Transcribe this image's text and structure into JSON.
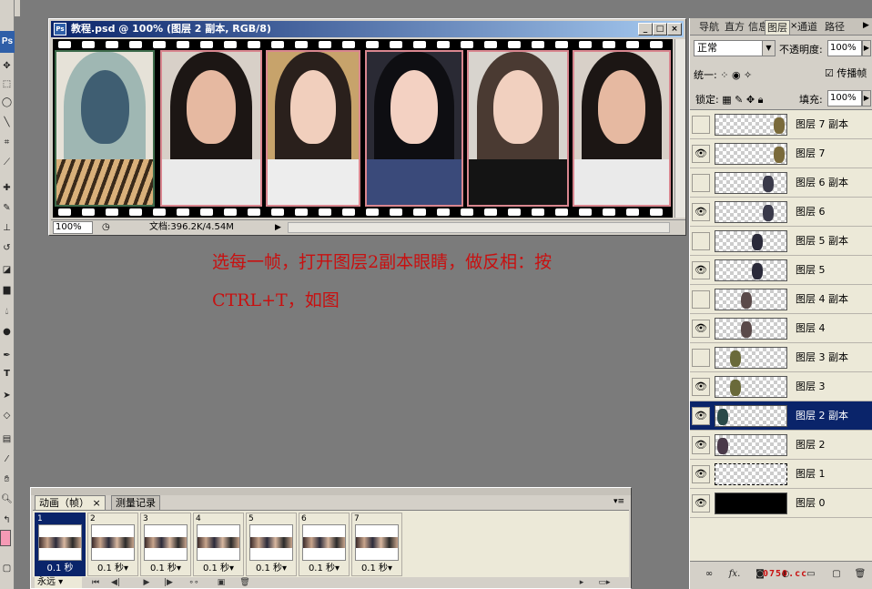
{
  "document": {
    "title": "教程.psd @ 100% (图层 2 副本, RGB/8)",
    "zoom": "100%",
    "info": "文档:396.2K/4.54M",
    "window_buttons": [
      "_",
      "□",
      "×"
    ]
  },
  "toolbox": {
    "logo": "Ps",
    "tools": [
      "move-icon",
      "marquee-icon",
      "lasso-icon",
      "wand-icon",
      "crop-icon",
      "slice-icon",
      "heal-icon",
      "brush-icon",
      "stamp-icon",
      "history-brush-icon",
      "eraser-icon",
      "gradient-icon",
      "blur-icon",
      "dodge-icon",
      "pen-icon",
      "type-icon",
      "path-select-icon",
      "shape-icon",
      "notes-icon",
      "eyedropper-icon",
      "hand-icon",
      "zoom-icon"
    ],
    "type_glyph": "T",
    "foreground_color": "#f59ab5"
  },
  "instruction": {
    "line1": "选每一帧，打开图层2副本眼睛，做反相：按",
    "line2": "CTRL+T，如图"
  },
  "animation": {
    "tabs": [
      "动画（帧）",
      "测量记录"
    ],
    "frames": [
      {
        "num": "1",
        "delay": "0.1 秒",
        "selected": true
      },
      {
        "num": "2",
        "delay": "0.1 秒▾",
        "selected": false
      },
      {
        "num": "3",
        "delay": "0.1 秒▾",
        "selected": false
      },
      {
        "num": "4",
        "delay": "0.1 秒▾",
        "selected": false
      },
      {
        "num": "5",
        "delay": "0.1 秒▾",
        "selected": false
      },
      {
        "num": "6",
        "delay": "0.1 秒▾",
        "selected": false
      },
      {
        "num": "7",
        "delay": "0.1 秒▾",
        "selected": false
      }
    ],
    "loop": "永远"
  },
  "layers_panel": {
    "tabs": [
      "导航",
      "直方",
      "信息",
      "图层",
      "通道",
      "路径"
    ],
    "active_tab": "图层",
    "blend_mode": "正常",
    "opacity_label": "不透明度:",
    "opacity": "100%",
    "unify_label": "统一:",
    "propagate_label": "传播帧",
    "lock_label": "锁定:",
    "fill_label": "填充:",
    "fill": "100%",
    "layers": [
      {
        "name": "图层 7 副本",
        "visible": false,
        "selected": false,
        "thumb": "checker"
      },
      {
        "name": "图层 7",
        "visible": true,
        "selected": false,
        "thumb": "checker"
      },
      {
        "name": "图层 6 副本",
        "visible": false,
        "selected": false,
        "thumb": "checker"
      },
      {
        "name": "图层 6",
        "visible": true,
        "selected": false,
        "thumb": "checker"
      },
      {
        "name": "图层 5 副本",
        "visible": false,
        "selected": false,
        "thumb": "checker"
      },
      {
        "name": "图层 5",
        "visible": true,
        "selected": false,
        "thumb": "checker"
      },
      {
        "name": "图层 4 副本",
        "visible": false,
        "selected": false,
        "thumb": "checker"
      },
      {
        "name": "图层 4",
        "visible": true,
        "selected": false,
        "thumb": "checker"
      },
      {
        "name": "图层 3 副本",
        "visible": false,
        "selected": false,
        "thumb": "checker"
      },
      {
        "name": "图层 3",
        "visible": true,
        "selected": false,
        "thumb": "checker"
      },
      {
        "name": "图层 2 副本",
        "visible": true,
        "selected": true,
        "thumb": "checker"
      },
      {
        "name": "图层 2",
        "visible": true,
        "selected": false,
        "thumb": "checker"
      },
      {
        "name": "图层 1",
        "visible": true,
        "selected": false,
        "thumb": "checker"
      },
      {
        "name": "图层 0",
        "visible": true,
        "selected": false,
        "thumb": "black"
      }
    ],
    "bottom_icons": [
      "link-icon",
      "fx-icon",
      "mask-icon",
      "adjustment-icon",
      "group-icon",
      "new-layer-icon",
      "trash-icon"
    ],
    "fx_glyph": "fx."
  },
  "watermark": "0750.cc",
  "colors": {
    "workspace": "#7b7b7b",
    "panel": "#d4d0c8",
    "selection": "#0a246a",
    "instruction_text": "#c81010",
    "film_border": "#d9868f"
  }
}
